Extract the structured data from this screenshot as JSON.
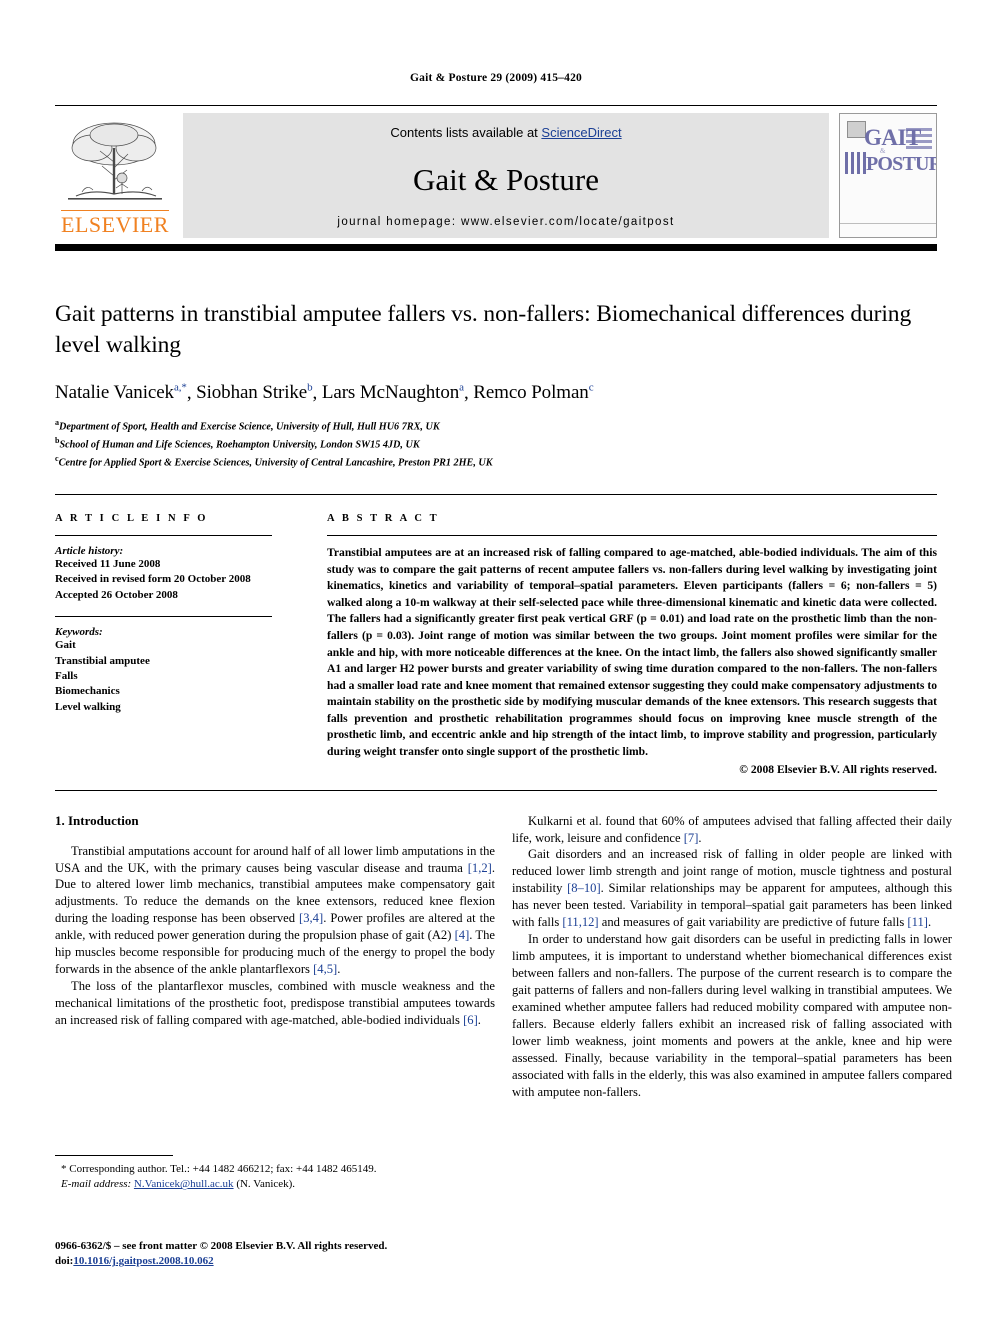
{
  "running_head": "Gait & Posture 29 (2009) 415–420",
  "banner": {
    "contents_prefix": "Contents lists available at ",
    "sciencedirect": "ScienceDirect",
    "journal_title": "Gait & Posture",
    "homepage": "journal homepage: www.elsevier.com/locate/gaitpost",
    "publisher": "ELSEVIER",
    "cover": {
      "line1": "GAIT",
      "amp": "&",
      "line2": "POSTURE"
    }
  },
  "article": {
    "title": "Gait patterns in transtibial amputee fallers vs. non-fallers: Biomechanical differences during level walking",
    "authors": [
      {
        "name": "Natalie Vanicek",
        "sup": "a,*"
      },
      {
        "name": "Siobhan Strike",
        "sup": "b"
      },
      {
        "name": "Lars McNaughton",
        "sup": "a"
      },
      {
        "name": "Remco Polman",
        "sup": "c"
      }
    ],
    "affiliations": [
      {
        "marker": "a",
        "text": "Department of Sport, Health and Exercise Science, University of Hull, Hull HU6 7RX, UK"
      },
      {
        "marker": "b",
        "text": "School of Human and Life Sciences, Roehampton University, London SW15 4JD, UK"
      },
      {
        "marker": "c",
        "text": "Centre for Applied Sport & Exercise Sciences, University of Central Lancashire, Preston PR1 2HE, UK"
      }
    ]
  },
  "article_info": {
    "heading": "A R T I C L E  I N F O",
    "history_label": "Article history:",
    "history": [
      "Received 11 June 2008",
      "Received in revised form 20 October 2008",
      "Accepted 26 October 2008"
    ],
    "keywords_label": "Keywords:",
    "keywords": [
      "Gait",
      "Transtibial amputee",
      "Falls",
      "Biomechanics",
      "Level walking"
    ]
  },
  "abstract": {
    "heading": "A B S T R A C T",
    "text": "Transtibial amputees are at an increased risk of falling compared to age-matched, able-bodied individuals. The aim of this study was to compare the gait patterns of recent amputee fallers vs. non-fallers during level walking by investigating joint kinematics, kinetics and variability of temporal–spatial parameters. Eleven participants (fallers = 6; non-fallers = 5) walked along a 10-m walkway at their self-selected pace while three-dimensional kinematic and kinetic data were collected. The fallers had a significantly greater first peak vertical GRF (p = 0.01) and load rate on the prosthetic limb than the non-fallers (p = 0.03). Joint range of motion was similar between the two groups. Joint moment profiles were similar for the ankle and hip, with more noticeable differences at the knee. On the intact limb, the fallers also showed significantly smaller A1 and larger H2 power bursts and greater variability of swing time duration compared to the non-fallers. The non-fallers had a smaller load rate and knee moment that remained extensor suggesting they could make compensatory adjustments to maintain stability on the prosthetic side by modifying muscular demands of the knee extensors. This research suggests that falls prevention and prosthetic rehabilitation programmes should focus on improving knee muscle strength of the prosthetic limb, and eccentric ankle and hip strength of the intact limb, to improve stability and progression, particularly during weight transfer onto single support of the prosthetic limb.",
    "copyright": "© 2008 Elsevier B.V. All rights reserved."
  },
  "body": {
    "section_heading": "1. Introduction",
    "left_paragraphs": [
      "Transtibial amputations account for around half of all lower limb amputations in the USA and the UK, with the primary causes being vascular disease and trauma [1,2]. Due to altered lower limb mechanics, transtibial amputees make compensatory gait adjustments. To reduce the demands on the knee extensors, reduced knee flexion during the loading response has been observed [3,4]. Power profiles are altered at the ankle, with reduced power generation during the propulsion phase of gait (A2) [4]. The hip muscles become responsible for producing much of the energy to propel the body forwards in the absence of the ankle plantarflexors [4,5].",
      "The loss of the plantarflexor muscles, combined with muscle weakness and the mechanical limitations of the prosthetic foot, predispose transtibial amputees towards an increased risk of falling compared with age-matched, able-bodied individuals [6]."
    ],
    "right_paragraphs": [
      "Kulkarni et al. found that 60% of amputees advised that falling affected their daily life, work, leisure and confidence [7].",
      "Gait disorders and an increased risk of falling in older people are linked with reduced lower limb strength and joint range of motion, muscle tightness and postural instability [8–10]. Similar relationships may be apparent for amputees, although this has never been tested. Variability in temporal–spatial gait parameters has been linked with falls [11,12] and measures of gait variability are predictive of future falls [11].",
      "In order to understand how gait disorders can be useful in predicting falls in lower limb amputees, it is important to understand whether biomechanical differences exist between fallers and non-fallers. The purpose of the current research is to compare the gait patterns of fallers and non-fallers during level walking in transtibial amputees. We examined whether amputee fallers had reduced mobility compared with amputee non-fallers. Because elderly fallers exhibit an increased risk of falling associated with lower limb weakness, joint moments and powers at the ankle, knee and hip were assessed. Finally, because variability in the temporal–spatial parameters has been associated with falls in the elderly, this was also examined in amputee fallers compared with amputee non-fallers."
    ]
  },
  "footnotes": {
    "corresponding": "* Corresponding author. Tel.: +44 1482 466212; fax: +44 1482 465149.",
    "email_label": "E-mail address:",
    "email": "N.Vanicek@hull.ac.uk",
    "email_suffix": "(N. Vanicek)."
  },
  "imprint": {
    "line1": "0966-6362/$ – see front matter © 2008 Elsevier B.V. All rights reserved.",
    "doi_prefix": "doi:",
    "doi": "10.1016/j.gaitpost.2008.10.062"
  },
  "colors": {
    "link": "#1b3f94",
    "elsevier_orange": "#F08121",
    "cover_purple": "#6f6fa8",
    "banner_grey": "#e3e3e3"
  }
}
